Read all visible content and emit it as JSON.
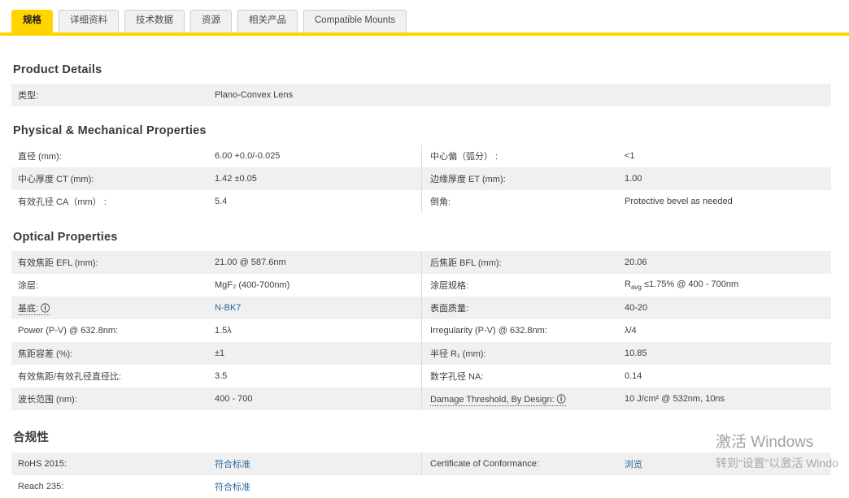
{
  "colors": {
    "accent_yellow": "#ffd400",
    "row_shade": "#f0f0f0",
    "link_blue": "#2d6a9f",
    "text": "#3f3f3f"
  },
  "icons": {
    "info": "ⓘ"
  },
  "tabs": [
    {
      "label": "规格",
      "active": true
    },
    {
      "label": "详细资料",
      "active": false
    },
    {
      "label": "技术数据",
      "active": false
    },
    {
      "label": "资源",
      "active": false
    },
    {
      "label": "相关产品",
      "active": false
    },
    {
      "label": "Compatible Mounts",
      "active": false
    }
  ],
  "sections": [
    {
      "title": "Product Details",
      "rows": [
        {
          "left": {
            "label": "类型:",
            "value": "Plano-Convex Lens"
          }
        }
      ]
    },
    {
      "title": "Physical & Mechanical Properties",
      "rows": [
        {
          "left": {
            "label": "直径 (mm):",
            "value": "6.00 +0.0/-0.025"
          },
          "right": {
            "label": "中心偏（弧分） :",
            "value": "<1"
          }
        },
        {
          "left": {
            "label": "中心厚度 CT (mm):",
            "value": "1.42 ±0.05"
          },
          "right": {
            "label": "边缘厚度 ET (mm):",
            "value": "1.00"
          }
        },
        {
          "left": {
            "label": "有效孔径 CA（mm） :",
            "value": "5.4"
          },
          "right": {
            "label": "倒角:",
            "value": "Protective bevel as needed"
          }
        }
      ]
    },
    {
      "title": "Optical Properties",
      "rows": [
        {
          "left": {
            "label": "有效焦距 EFL (mm):",
            "value": "21.00 @ 587.6nm"
          },
          "right": {
            "label": "后焦距 BFL (mm):",
            "value": "20.06"
          }
        },
        {
          "left": {
            "label": "涂层:",
            "value": "MgF₂ (400-700nm)"
          },
          "right": {
            "label": "涂层规格:",
            "value_pre": "R",
            "value_sub": "avg",
            "value_post": " ≤1.75% @ 400 - 700nm"
          }
        },
        {
          "left": {
            "label": "基底:",
            "value": "N-BK7"
          },
          "right": {
            "label": "表面质量:",
            "value": "40-20"
          }
        },
        {
          "left": {
            "label": "Power (P-V) @ 632.8nm:",
            "value": "1.5λ"
          },
          "right": {
            "label": "Irregularity (P-V) @ 632.8nm:",
            "value": "λ/4"
          }
        },
        {
          "left": {
            "label": "焦距容差 (%):",
            "value": "±1"
          },
          "right": {
            "label": "半径 R₁ (mm):",
            "value": "10.85"
          }
        },
        {
          "left": {
            "label": "有效焦距/有效孔径直径比:",
            "value": "3.5"
          },
          "right": {
            "label": "数字孔径 NA:",
            "value": "0.14"
          }
        },
        {
          "left": {
            "label": "波长范围 (nm):",
            "value": "400 - 700"
          },
          "right": {
            "label": "Damage Threshold, By Design:",
            "value": "10 J/cm² @ 532nm, 10ns"
          }
        }
      ]
    },
    {
      "title": "合规性",
      "rows": [
        {
          "left": {
            "label": "RoHS 2015:",
            "value": "符合标准"
          },
          "right": {
            "label": "Certificate of Conformance:",
            "value": "浏览"
          }
        },
        {
          "left": {
            "label": "Reach 235:",
            "value": "符合标准"
          }
        }
      ]
    }
  ],
  "watermark": {
    "line1": "激活 Windows",
    "line2": "转到“设置”以激活 Windo"
  }
}
